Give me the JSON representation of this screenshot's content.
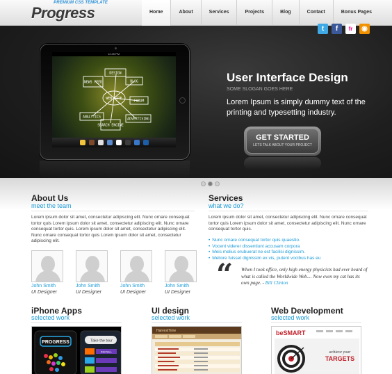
{
  "header": {
    "logo_tag": "PREMIUM CSS TEMPLATE",
    "logo": "Progress",
    "nav": [
      "Home",
      "About",
      "Services",
      "Projects",
      "Blog",
      "Contact",
      "Bonus Pages"
    ]
  },
  "social": [
    {
      "icon": "twitter-icon",
      "glyph": "t"
    },
    {
      "icon": "facebook-icon",
      "glyph": "f"
    },
    {
      "icon": "flickr-icon",
      "glyph": "fr"
    },
    {
      "icon": "rss-icon",
      "glyph": "◉"
    }
  ],
  "tablet": {
    "time": "12:45 PM",
    "diagram_nodes": [
      "DESIGN",
      "NEWS FEED",
      "BLOG",
      "WEB SITE",
      "FORUM",
      "ANALYTICS",
      "SEARCH ENGINE",
      "ADVERTISING"
    ]
  },
  "hero": {
    "title": "User Interface Design",
    "slogan": "SOME SLOGAN GOES HERE",
    "text": "Lorem Ipsum is simply dummy text of the printing and typesetting industry.",
    "cta_label": "GET STARTED",
    "cta_sub": "LETS TALK ABOUT YOUR PROJECT"
  },
  "slider": {
    "count": 3,
    "active": 2
  },
  "about": {
    "title": "About Us",
    "subtitle": "meet the team",
    "text": "Lorem ipsum dolor sit amet, consectetur adipiscing elit. Nunc ornare consequat tortor quis Lorem ipsum dolor sit amet, consectetur adipiscing elit. Nunc ornare consequat tortor quis. Lorem ipsum dolor sit amet, consectetur adipiscing elit. Nunc ornare consequat tortor quis Lorem ipsum dolor sit amet, consectetur adipiscing elit.",
    "team": [
      {
        "name": "John Smith",
        "role": "UI Designer"
      },
      {
        "name": "John Smith",
        "role": "UI Designer"
      },
      {
        "name": "John Smith",
        "role": "UI Designer"
      },
      {
        "name": "John Smith",
        "role": "UI Designer"
      }
    ]
  },
  "services": {
    "title": "Services",
    "subtitle": "what we do?",
    "text": "Lorem ipsum dolor sit amet, consectetur adipiscing elit. Nunc ornare consequat tortor quis Lorem ipsum dolor sit amet, consectetur adipiscing elit. Nunc ornare consequat tortor quis.",
    "list": [
      "Nunc ornare consequat tortor quis quaestio.",
      "Vocent viderer dissentiunt accusam corpora",
      "Meis melius erubuerat ne est facilisi dignissim.",
      "Meliore fuisset dignissim ex vis, putent vocibus has eu"
    ],
    "quote": "When I took office, only high energy physicists had ever heard of what is called the Worldwide Web.... Now even my cat has its own page. -",
    "quote_author": "Bill Clinton"
  },
  "works": [
    {
      "title": "iPhone Apps",
      "subtitle": "selected work"
    },
    {
      "title": "UI design",
      "subtitle": "selected work"
    },
    {
      "title": "Web Development",
      "subtitle": "selected work"
    }
  ],
  "thumbs": {
    "iphone_logo": "PROGRESS",
    "iphone_tour": "Take the tour",
    "iphone_btn": "INSTALL",
    "ui_title": "HarvestTime",
    "web_logo": "beSMART",
    "web_text1": "achieve your",
    "web_text2": "TARGETS"
  },
  "colors": {
    "accent": "#1a9ad6",
    "hero_bg": "#1f1f1f"
  }
}
